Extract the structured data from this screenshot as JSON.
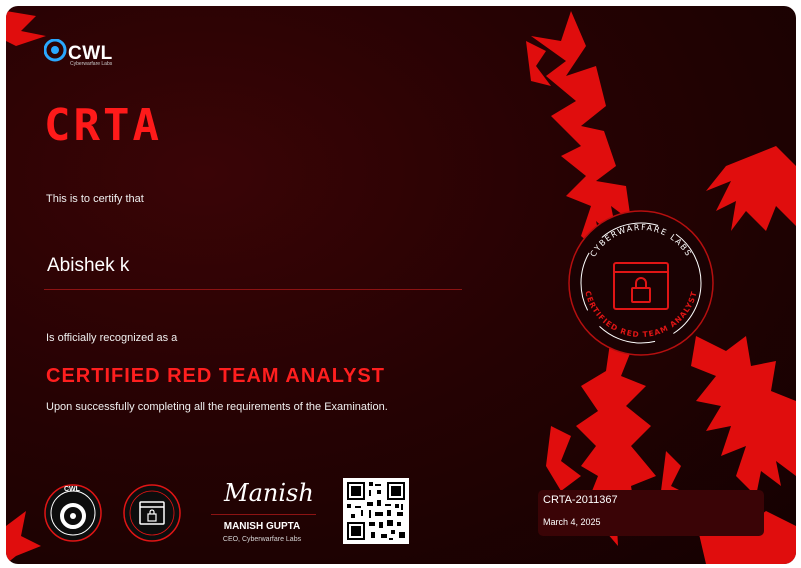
{
  "brand": {
    "logo_text": "CWL",
    "logo_sub": "Cyberwarfare Labs"
  },
  "certificate": {
    "acronym": "CRTA",
    "intro": "This is to certify that",
    "recipient": "Abishek k",
    "recognized": "Is officially recognized as a",
    "role": "CERTIFIED RED TEAM ANALYST",
    "completion": "Upon successfully completing all the requirements of the Examination."
  },
  "seal": {
    "top_text": "CYBERWARFARE LABS",
    "bottom_text": "CERTIFIED RED TEAM ANALYST"
  },
  "badges": [
    {
      "label": "CWL"
    }
  ],
  "signature": {
    "script": "Manish",
    "name": "MANISH GUPTA",
    "role": "CEO, Cyberwarfare Labs"
  },
  "credential": {
    "id": "CRTA-2011367",
    "date": "March 4, 2025"
  },
  "colors": {
    "accent_red": "#ff1a1a",
    "background_dark": "#1c0202",
    "info_box": "#3a0406"
  }
}
